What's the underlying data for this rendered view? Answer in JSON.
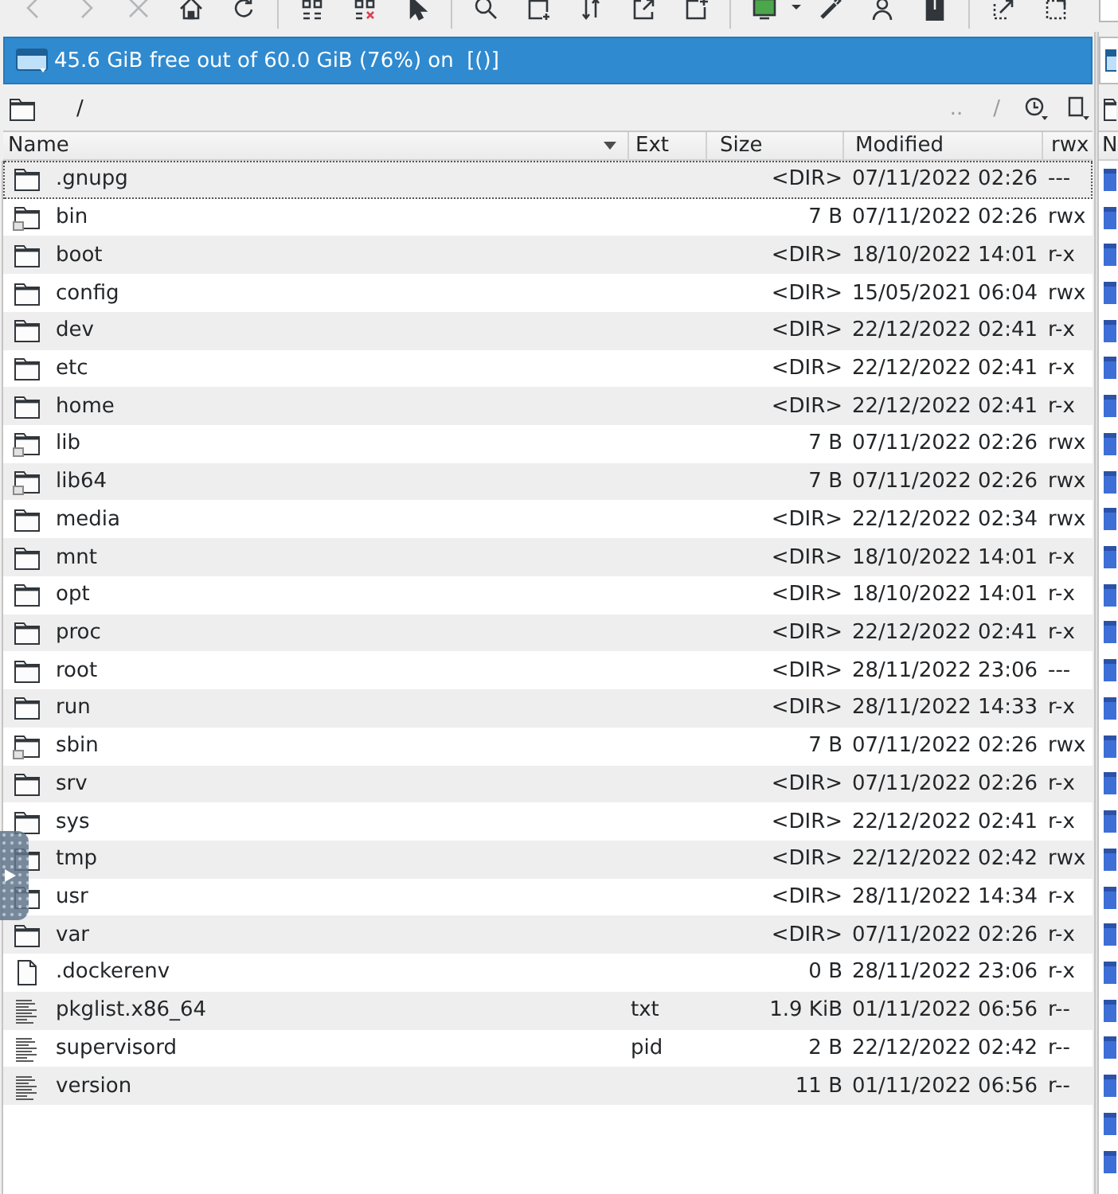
{
  "toolbar": {
    "groups": [
      [
        {
          "kind": "back",
          "disabled": true
        },
        {
          "kind": "forward",
          "disabled": true
        },
        {
          "kind": "stop",
          "disabled": true
        },
        {
          "kind": "home",
          "disabled": false
        },
        {
          "kind": "refresh",
          "disabled": false
        }
      ],
      [
        {
          "kind": "select-group",
          "disabled": false
        },
        {
          "kind": "unselect-group",
          "disabled": false
        },
        {
          "kind": "pointer",
          "disabled": false
        }
      ],
      [
        {
          "kind": "search",
          "disabled": false
        },
        {
          "kind": "new-file",
          "disabled": false
        },
        {
          "kind": "sync",
          "disabled": false
        },
        {
          "kind": "export",
          "disabled": false
        },
        {
          "kind": "new-item",
          "disabled": false
        }
      ],
      [
        {
          "kind": "terminal",
          "disabled": false
        },
        {
          "kind": "menu-caret",
          "disabled": false
        },
        {
          "kind": "pen",
          "disabled": false
        },
        {
          "kind": "user",
          "disabled": false
        },
        {
          "kind": "archive",
          "disabled": false
        }
      ],
      [
        {
          "kind": "select-region",
          "disabled": false
        },
        {
          "kind": "dotted-square",
          "disabled": false
        }
      ]
    ]
  },
  "panel": {
    "free_space_bar": {
      "active": true,
      "text": "45.6 GiB free out of 60.0 GiB (76%) on  [()]"
    },
    "path_bar": {
      "path": "/",
      "parent_button": "..",
      "root_button": "/"
    }
  },
  "table": {
    "columns": [
      {
        "label": "Name",
        "sorted": true
      },
      {
        "label": "Ext",
        "sorted": false
      },
      {
        "label": "Size",
        "sorted": false
      },
      {
        "label": "Modified",
        "sorted": false
      },
      {
        "label": "rwx",
        "sorted": false
      }
    ],
    "rows": [
      {
        "kind": "folder",
        "name": ".gnupg",
        "size": "<DIR>",
        "modified": "07/11/2022 02:26",
        "rwx": "---",
        "focused": true
      },
      {
        "kind": "folder-link",
        "name": "bin",
        "size": "7 B",
        "modified": "07/11/2022 02:26",
        "rwx": "rwx",
        "focused": false
      },
      {
        "kind": "folder",
        "name": "boot",
        "size": "<DIR>",
        "modified": "18/10/2022 14:01",
        "rwx": "r-x",
        "focused": false
      },
      {
        "kind": "folder",
        "name": "config",
        "size": "<DIR>",
        "modified": "15/05/2021 06:04",
        "rwx": "rwx",
        "focused": false
      },
      {
        "kind": "folder",
        "name": "dev",
        "size": "<DIR>",
        "modified": "22/12/2022 02:41",
        "rwx": "r-x",
        "focused": false
      },
      {
        "kind": "folder",
        "name": "etc",
        "size": "<DIR>",
        "modified": "22/12/2022 02:41",
        "rwx": "r-x",
        "focused": false
      },
      {
        "kind": "folder",
        "name": "home",
        "size": "<DIR>",
        "modified": "22/12/2022 02:41",
        "rwx": "r-x",
        "focused": false
      },
      {
        "kind": "folder-link",
        "name": "lib",
        "size": "7 B",
        "modified": "07/11/2022 02:26",
        "rwx": "rwx",
        "focused": false
      },
      {
        "kind": "folder-link",
        "name": "lib64",
        "size": "7 B",
        "modified": "07/11/2022 02:26",
        "rwx": "rwx",
        "focused": false
      },
      {
        "kind": "folder",
        "name": "media",
        "size": "<DIR>",
        "modified": "22/12/2022 02:34",
        "rwx": "rwx",
        "focused": false
      },
      {
        "kind": "folder",
        "name": "mnt",
        "size": "<DIR>",
        "modified": "18/10/2022 14:01",
        "rwx": "r-x",
        "focused": false
      },
      {
        "kind": "folder",
        "name": "opt",
        "size": "<DIR>",
        "modified": "18/10/2022 14:01",
        "rwx": "r-x",
        "focused": false
      },
      {
        "kind": "folder",
        "name": "proc",
        "size": "<DIR>",
        "modified": "22/12/2022 02:41",
        "rwx": "r-x",
        "focused": false
      },
      {
        "kind": "folder",
        "name": "root",
        "size": "<DIR>",
        "modified": "28/11/2022 23:06",
        "rwx": "---",
        "focused": false
      },
      {
        "kind": "folder",
        "name": "run",
        "size": "<DIR>",
        "modified": "28/11/2022 14:33",
        "rwx": "r-x",
        "focused": false
      },
      {
        "kind": "folder-link",
        "name": "sbin",
        "size": "7 B",
        "modified": "07/11/2022 02:26",
        "rwx": "rwx",
        "focused": false
      },
      {
        "kind": "folder",
        "name": "srv",
        "size": "<DIR>",
        "modified": "07/11/2022 02:26",
        "rwx": "r-x",
        "focused": false
      },
      {
        "kind": "folder",
        "name": "sys",
        "size": "<DIR>",
        "modified": "22/12/2022 02:41",
        "rwx": "r-x",
        "focused": false
      },
      {
        "kind": "folder",
        "name": "tmp",
        "size": "<DIR>",
        "modified": "22/12/2022 02:42",
        "rwx": "rwx",
        "focused": false
      },
      {
        "kind": "folder",
        "name": "usr",
        "size": "<DIR>",
        "modified": "28/11/2022 14:34",
        "rwx": "r-x",
        "focused": false
      },
      {
        "kind": "folder",
        "name": "var",
        "size": "<DIR>",
        "modified": "07/11/2022 02:26",
        "rwx": "r-x",
        "focused": false
      },
      {
        "kind": "file",
        "name": ".dockerenv",
        "size": "0 B",
        "modified": "28/11/2022 23:06",
        "rwx": "r-x",
        "focused": false
      },
      {
        "kind": "text",
        "name": "pkglist.x86_64",
        "ext": "txt",
        "size": "1.9 KiB",
        "modified": "01/11/2022 06:56",
        "rwx": "r--",
        "focused": false
      },
      {
        "kind": "text",
        "name": "supervisord",
        "ext": "pid",
        "size": "2 B",
        "modified": "22/12/2022 02:42",
        "rwx": "r--",
        "focused": false
      },
      {
        "kind": "text",
        "name": "version",
        "size": "11 B",
        "modified": "01/11/2022 06:56",
        "rwx": "r--",
        "focused": false
      }
    ]
  },
  "other_panel": {
    "active": false,
    "column_1": "N"
  }
}
